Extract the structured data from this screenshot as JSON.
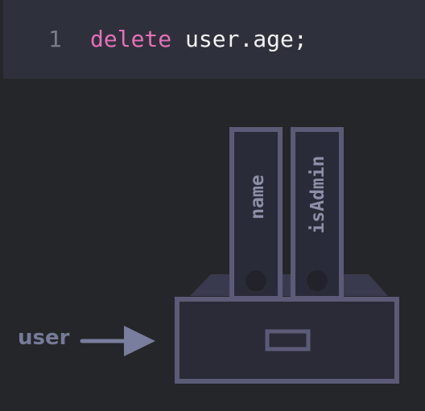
{
  "code": {
    "line_number": "1",
    "keyword": "delete",
    "rest": " user.age;"
  },
  "diagram": {
    "variable_label": "user",
    "folders": [
      {
        "label": "name"
      },
      {
        "label": "isAdmin"
      }
    ],
    "colors": {
      "outline": "#5b5b78",
      "arrow": "#797d9e",
      "folder_text": "#8c8fa8",
      "background": "#252629",
      "code_background": "#2e313b",
      "keyword": "#e86fba"
    }
  }
}
